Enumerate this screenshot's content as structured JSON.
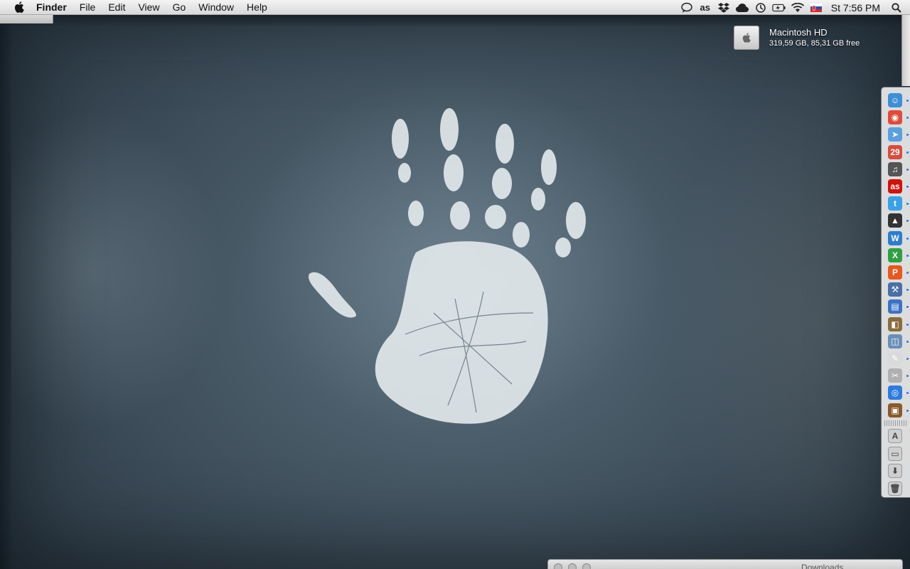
{
  "menubar": {
    "app_name": "Finder",
    "menus": [
      "File",
      "Edit",
      "View",
      "Go",
      "Window",
      "Help"
    ],
    "status_icons": [
      "speech-bubble-icon",
      "lastfm-icon",
      "dropbox-icon",
      "icloud-icon",
      "time-machine-icon",
      "battery-icon",
      "wifi-icon",
      "input-source-flag-icon"
    ],
    "clock": "St 7:56 PM"
  },
  "desktop": {
    "drive": {
      "name": "Macintosh HD",
      "info": "319,59 GB, 85,31 GB free"
    }
  },
  "dock": {
    "apps": [
      {
        "icon": "finder-icon",
        "color": "#3d8fd6",
        "glyph": "☺",
        "running": true
      },
      {
        "icon": "chrome-icon",
        "color": "#e04b3a",
        "glyph": "◉",
        "running": true
      },
      {
        "icon": "mail-plane-icon",
        "color": "#5aa0e0",
        "glyph": "➤",
        "running": true
      },
      {
        "icon": "calendar-icon",
        "color": "#d94c3d",
        "glyph": "29",
        "running": true
      },
      {
        "icon": "itunes-icon",
        "color": "#555555",
        "glyph": "♫",
        "running": true
      },
      {
        "icon": "lastfm-app-icon",
        "color": "#d51007",
        "glyph": "as",
        "running": true
      },
      {
        "icon": "twitter-icon",
        "color": "#3aa0e8",
        "glyph": "t",
        "running": true
      },
      {
        "icon": "android-icon",
        "color": "#333333",
        "glyph": "▲",
        "running": true
      },
      {
        "icon": "word-icon",
        "color": "#2b7dd0",
        "glyph": "W",
        "running": true
      },
      {
        "icon": "excel-icon",
        "color": "#2ea043",
        "glyph": "X",
        "running": true
      },
      {
        "icon": "powerpoint-icon",
        "color": "#e8581c",
        "glyph": "P",
        "running": true
      },
      {
        "icon": "xcode-icon",
        "color": "#4a6fa5",
        "glyph": "⚒",
        "running": true
      },
      {
        "icon": "chart-app-icon",
        "color": "#3c73c4",
        "glyph": "▤",
        "running": true
      },
      {
        "icon": "keynote-icon",
        "color": "#8a6d3b",
        "glyph": "◧",
        "running": true
      },
      {
        "icon": "preview-icon",
        "color": "#6b8fb8",
        "glyph": "◫",
        "running": true
      },
      {
        "icon": "textedit-icon",
        "color": "#dadada",
        "glyph": "✎",
        "running": true
      },
      {
        "icon": "script-editor-icon",
        "color": "#b0b0b0",
        "glyph": "✂",
        "running": true
      },
      {
        "icon": "safari-icon",
        "color": "#2d7be0",
        "glyph": "◎",
        "running": true
      },
      {
        "icon": "photo-app-icon",
        "color": "#8a5a2b",
        "glyph": "▣",
        "running": true
      }
    ],
    "stacks": [
      {
        "icon": "applications-stack-icon",
        "glyph": "A"
      },
      {
        "icon": "documents-stack-icon",
        "glyph": "▭"
      },
      {
        "icon": "downloads-stack-icon",
        "glyph": "⬇"
      },
      {
        "icon": "trash-icon",
        "glyph": "🗑"
      }
    ]
  },
  "downloads_window": {
    "title": "Downloads"
  }
}
